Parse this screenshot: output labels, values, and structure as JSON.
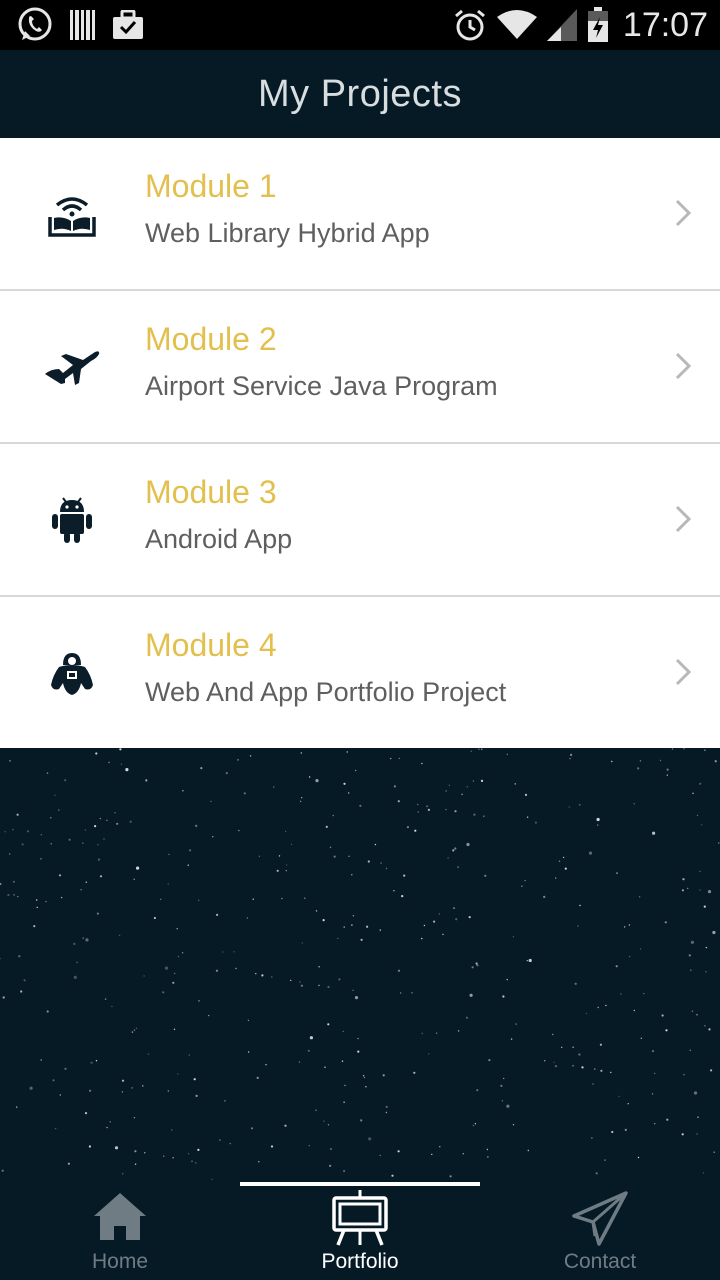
{
  "status_bar": {
    "time": "17:07",
    "left_icons": [
      "whatsapp-icon",
      "barcode-icon",
      "briefcase-check-icon"
    ],
    "right_icons": [
      "alarm-icon",
      "wifi-icon",
      "signal-icon",
      "battery-icon"
    ]
  },
  "header": {
    "title": "My Projects"
  },
  "projects": [
    {
      "title": "Module 1",
      "description": "Web Library Hybrid App",
      "icon": "wifi-book-icon"
    },
    {
      "title": "Module 2",
      "description": "Airport Service Java Program",
      "icon": "airplane-icon"
    },
    {
      "title": "Module 3",
      "description": "Android App",
      "icon": "android-icon"
    },
    {
      "title": "Module 4",
      "description": "Web And App Portfolio Project",
      "icon": "robot-icon"
    }
  ],
  "bottom_nav": {
    "tabs": [
      {
        "label": "Home",
        "icon": "home-icon",
        "active": false
      },
      {
        "label": "Portfolio",
        "icon": "easel-icon",
        "active": true
      },
      {
        "label": "Contact",
        "icon": "paper-plane-icon",
        "active": false
      }
    ]
  },
  "colors": {
    "background": "#061a26",
    "module_title": "#e3c04e",
    "description": "#5f5f5f",
    "nav_inactive": "#6f7c84",
    "nav_active": "#ffffff"
  }
}
